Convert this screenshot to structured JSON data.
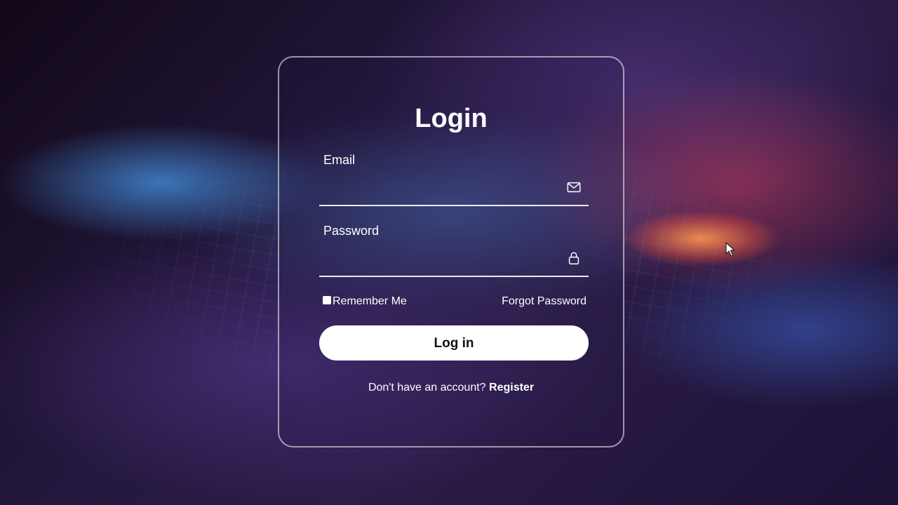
{
  "form": {
    "title": "Login",
    "email_label": "Email",
    "email_value": "",
    "password_label": "Password",
    "password_value": "",
    "email_icon": "mail-icon",
    "password_icon": "lock-icon",
    "remember_label": "Remember Me",
    "remember_checked": false,
    "forgot_label": "Forgot Password",
    "submit_label": "Log in",
    "register_prompt": "Don't have an account?",
    "register_label": "Register"
  },
  "colors": {
    "card_border": "#ffffff",
    "button_bg": "#ffffff",
    "button_text": "#111111",
    "text": "#ffffff"
  }
}
